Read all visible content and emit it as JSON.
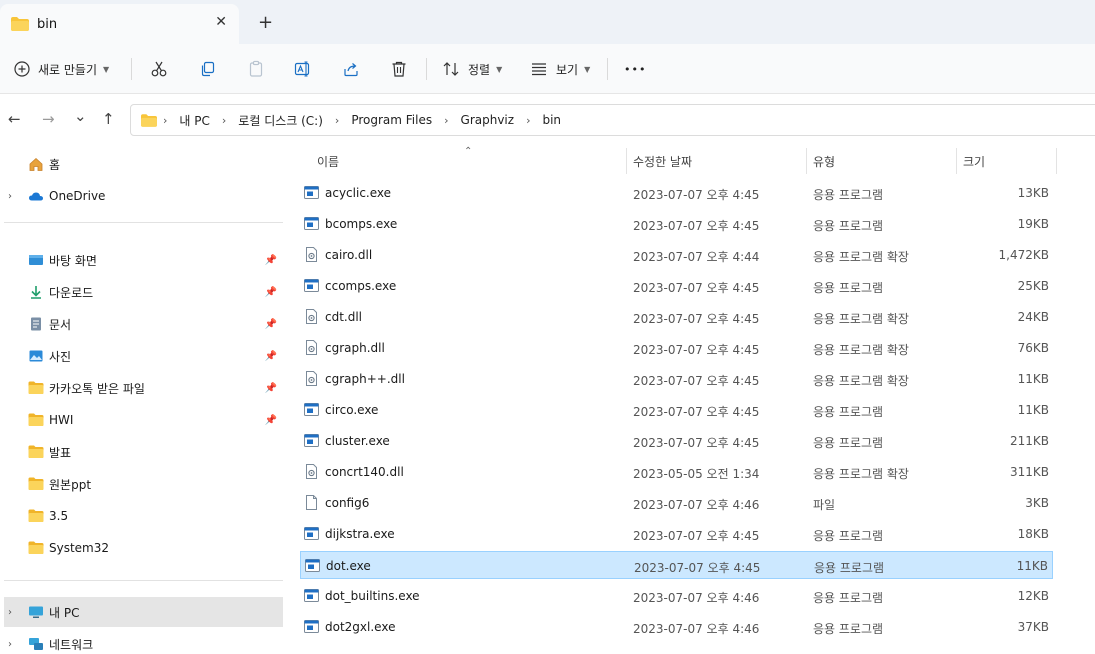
{
  "tab": {
    "title": "bin",
    "close": "✕",
    "new": "+"
  },
  "toolbar": {
    "new_label": "새로 만들기",
    "sort_label": "정렬",
    "view_label": "보기",
    "more": "•••"
  },
  "nav": {
    "back": "←",
    "forward": "→",
    "recent": "⌄",
    "up": "↑",
    "breadcrumbs": [
      "내 PC",
      "로컬 디스크 (C:)",
      "Program Files",
      "Graphviz",
      "bin"
    ]
  },
  "sidebar": {
    "home": "홈",
    "onedrive": "OneDrive",
    "quick": [
      {
        "label": "바탕 화면",
        "icon": "desktop-icon",
        "pinned": true
      },
      {
        "label": "다운로드",
        "icon": "download-icon",
        "pinned": true
      },
      {
        "label": "문서",
        "icon": "document-icon",
        "pinned": true
      },
      {
        "label": "사진",
        "icon": "picture-icon",
        "pinned": true
      },
      {
        "label": "카카오톡 받은 파일",
        "icon": "folder-icon",
        "pinned": true
      },
      {
        "label": "HWI",
        "icon": "folder-icon",
        "pinned": true
      },
      {
        "label": "발표",
        "icon": "folder-icon",
        "pinned": false
      },
      {
        "label": "원본ppt",
        "icon": "folder-icon",
        "pinned": false
      },
      {
        "label": "3.5",
        "icon": "folder-icon",
        "pinned": false
      },
      {
        "label": "System32",
        "icon": "folder-icon",
        "pinned": false
      }
    ],
    "thispc": "내 PC",
    "network": "네트워크"
  },
  "columns": {
    "name": "이름",
    "date": "수정한 날짜",
    "type": "유형",
    "size": "크기"
  },
  "files": [
    {
      "name": "acyclic.exe",
      "date": "2023-07-07 오후 4:45",
      "type": "응용 프로그램",
      "size": "13KB",
      "kind": "exe"
    },
    {
      "name": "bcomps.exe",
      "date": "2023-07-07 오후 4:45",
      "type": "응용 프로그램",
      "size": "19KB",
      "kind": "exe"
    },
    {
      "name": "cairo.dll",
      "date": "2023-07-07 오후 4:44",
      "type": "응용 프로그램 확장",
      "size": "1,472KB",
      "kind": "dll"
    },
    {
      "name": "ccomps.exe",
      "date": "2023-07-07 오후 4:45",
      "type": "응용 프로그램",
      "size": "25KB",
      "kind": "exe"
    },
    {
      "name": "cdt.dll",
      "date": "2023-07-07 오후 4:45",
      "type": "응용 프로그램 확장",
      "size": "24KB",
      "kind": "dll"
    },
    {
      "name": "cgraph.dll",
      "date": "2023-07-07 오후 4:45",
      "type": "응용 프로그램 확장",
      "size": "76KB",
      "kind": "dll"
    },
    {
      "name": "cgraph++.dll",
      "date": "2023-07-07 오후 4:45",
      "type": "응용 프로그램 확장",
      "size": "11KB",
      "kind": "dll"
    },
    {
      "name": "circo.exe",
      "date": "2023-07-07 오후 4:45",
      "type": "응용 프로그램",
      "size": "11KB",
      "kind": "exe"
    },
    {
      "name": "cluster.exe",
      "date": "2023-07-07 오후 4:45",
      "type": "응용 프로그램",
      "size": "211KB",
      "kind": "exe"
    },
    {
      "name": "concrt140.dll",
      "date": "2023-05-05 오전 1:34",
      "type": "응용 프로그램 확장",
      "size": "311KB",
      "kind": "dll"
    },
    {
      "name": "config6",
      "date": "2023-07-07 오후 4:46",
      "type": "파일",
      "size": "3KB",
      "kind": "file"
    },
    {
      "name": "dijkstra.exe",
      "date": "2023-07-07 오후 4:45",
      "type": "응용 프로그램",
      "size": "18KB",
      "kind": "exe"
    },
    {
      "name": "dot.exe",
      "date": "2023-07-07 오후 4:45",
      "type": "응용 프로그램",
      "size": "11KB",
      "kind": "exe",
      "selected": true
    },
    {
      "name": "dot_builtins.exe",
      "date": "2023-07-07 오후 4:46",
      "type": "응용 프로그램",
      "size": "12KB",
      "kind": "exe"
    },
    {
      "name": "dot2gxl.exe",
      "date": "2023-07-07 오후 4:46",
      "type": "응용 프로그램",
      "size": "37KB",
      "kind": "exe"
    }
  ],
  "colors": {
    "accent": "#0067c0",
    "selected_bg": "#cce8ff",
    "folder": "#f8c53a"
  }
}
